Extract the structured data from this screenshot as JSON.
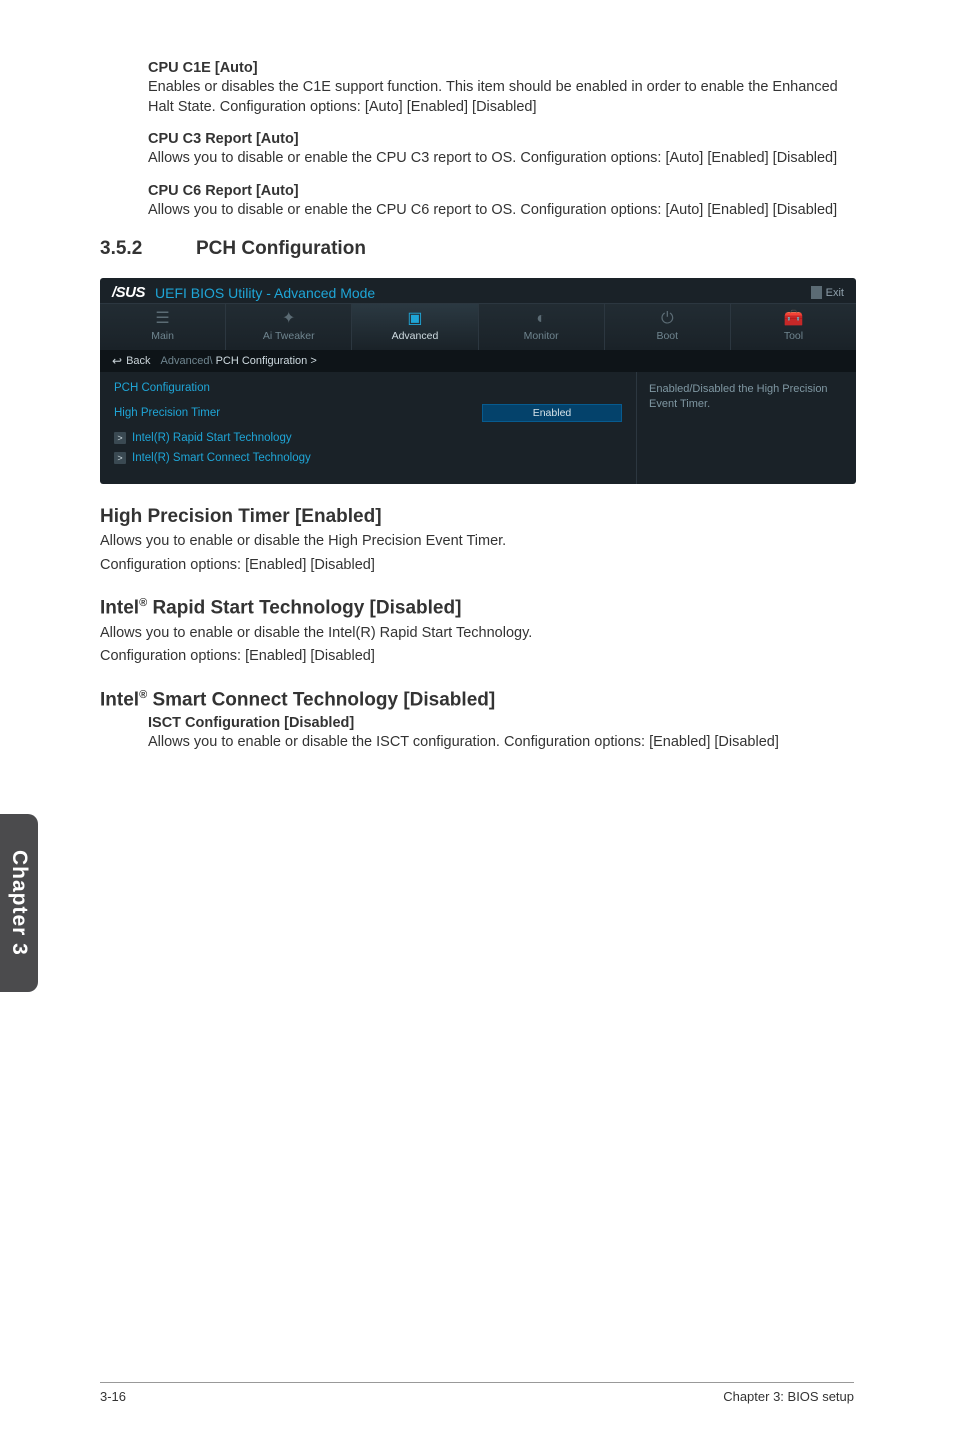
{
  "sections": {
    "c1e": {
      "title": "CPU C1E [Auto]",
      "body": "Enables or disables the C1E support function. This item should be enabled in order to enable the Enhanced Halt State. Configuration options: [Auto] [Enabled] [Disabled]"
    },
    "c3": {
      "title": "CPU C3 Report [Auto]",
      "body": "Allows you to disable or enable the CPU C3 report to OS. Configuration options: [Auto] [Enabled] [Disabled]"
    },
    "c6": {
      "title": "CPU C6 Report [Auto]",
      "body": "Allows you to disable or enable the CPU C6 report to OS. Configuration options: [Auto] [Enabled] [Disabled]"
    }
  },
  "heading": {
    "num": "3.5.2",
    "title": "PCH Configuration"
  },
  "bios": {
    "brand_prefix": "/SUS",
    "title": "UEFI BIOS Utility - Advanced Mode",
    "exit": "Exit",
    "tabs": {
      "main": "Main",
      "tweaker": "Ai  Tweaker",
      "advanced": "Advanced",
      "monitor": "Monitor",
      "boot": "Boot",
      "tool": "Tool"
    },
    "back": "Back",
    "path_prefix": "Advanced\\ ",
    "path_current": "PCH Configuration  >",
    "section_header": "PCH Configuration",
    "row_hpt_label": "High Precision Timer",
    "row_hpt_value": "Enabled",
    "link_rapid": "Intel(R) Rapid Start Technology",
    "link_smart": "Intel(R) Smart Connect Technology",
    "help": "Enabled/Disabled the High Precision Event Timer."
  },
  "hpt": {
    "title": "High Precision Timer [Enabled]",
    "l1": "Allows you to enable or disable the High Precision Event Timer.",
    "l2": "Configuration options: [Enabled] [Disabled]"
  },
  "rapid": {
    "title_pre": "Intel",
    "title_post": " Rapid Start Technology [Disabled]",
    "l1": "Allows you to enable or disable the Intel(R) Rapid Start Technology.",
    "l2": "Configuration options: [Enabled] [Disabled]"
  },
  "smart": {
    "title_pre": "Intel",
    "title_post": " Smart Connect Technology [Disabled]",
    "sub_title": "ISCT Configuration [Disabled]",
    "sub_body": "Allows you to enable or disable the ISCT configuration. Configuration options: [Enabled] [Disabled]"
  },
  "sidetab": "Chapter 3",
  "footer": {
    "left": "3-16",
    "right": "Chapter 3: BIOS setup"
  },
  "reg": "®"
}
